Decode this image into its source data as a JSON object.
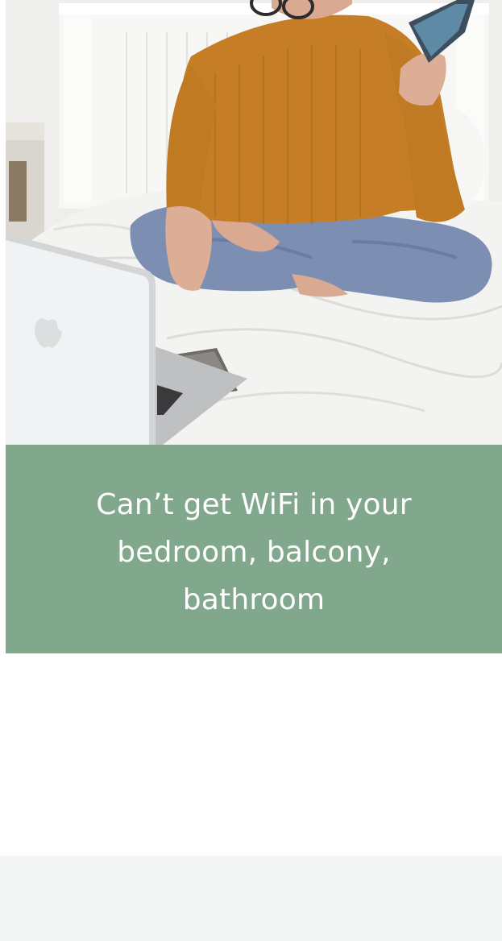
{
  "hero": {
    "caption": "Can’t get WiFi in your bedroom, balcony, bathroom"
  },
  "colors": {
    "caption_background": "#81a78c",
    "caption_text": "#ffffff",
    "footer_background": "#f4f6f5"
  }
}
